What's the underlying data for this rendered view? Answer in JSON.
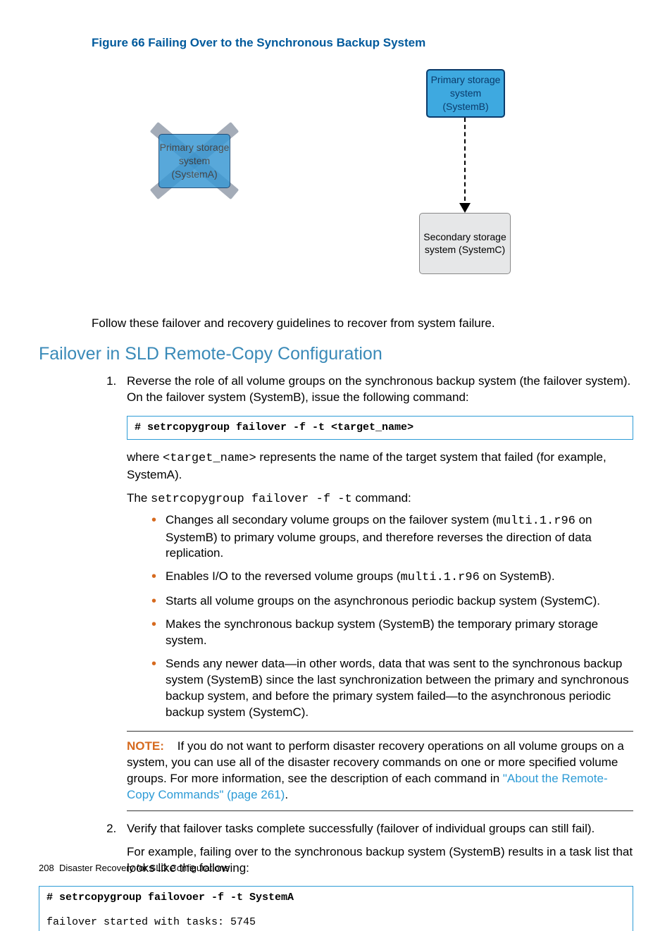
{
  "figure_caption": "Figure 66 Failing Over to the Synchronous Backup System",
  "diagram": {
    "box_a": "Primary storage system (SystemA)",
    "box_b": "Primary storage system (SystemB)",
    "box_c": "Secondary storage system (SystemC)"
  },
  "intro": "Follow these failover and recovery guidelines to recover from system failure.",
  "section_heading": "Failover in SLD Remote-Copy Configuration",
  "step1": {
    "text": "Reverse the role of all volume groups on the synchronous backup system (the failover system). On the failover system (SystemB), issue the following command:",
    "cmd": "# setrcopygroup failover -f -t <target_name>",
    "where_pre": "where ",
    "where_code": "<target_name>",
    "where_post": " represents the name of the target system that failed (for example, SystemA).",
    "intro2_pre": "The ",
    "intro2_code": "setrcopygroup failover -f -t",
    "intro2_post": " command:",
    "bullets": {
      "b1_pre": "Changes all secondary volume groups on the failover system (",
      "b1_code": "multi.1.r96",
      "b1_post": " on SystemB) to primary volume groups, and therefore reverses the direction of data replication.",
      "b2_pre": "Enables I/O to the reversed volume groups (",
      "b2_code": "multi.1.r96",
      "b2_post": " on SystemB).",
      "b3": "Starts all volume groups on the asynchronous periodic backup system (SystemC).",
      "b4": "Makes the synchronous backup system (SystemB) the temporary primary storage system.",
      "b5": "Sends any newer data—in other words, data that was sent to the synchronous backup system (SystemB) since the last synchronization between the primary and synchronous backup system, and before the primary system failed—to the asynchronous periodic backup system (SystemC)."
    },
    "note": {
      "label": "NOTE:",
      "pre": "If you do not want to perform disaster recovery operations on all volume groups on a system, you can use all of the disaster recovery commands on one or more specified volume groups. For more information, see the description of each command in ",
      "link": "\"About the Remote-Copy Commands\" (page 261)",
      "post": "."
    }
  },
  "step2": {
    "line1": "Verify that failover tasks complete successfully (failover of individual groups can still fail).",
    "line2": "For example, failing over to the synchronous backup system (SystemB) results in a task list that looks like the following:"
  },
  "code_block2": {
    "l1": "# setrcopygroup failovoer -f -t SystemA",
    "l2": "failover started with tasks: 5745"
  },
  "footer": {
    "page": "208",
    "title": "Disaster Recovery for SLD Configurations"
  }
}
